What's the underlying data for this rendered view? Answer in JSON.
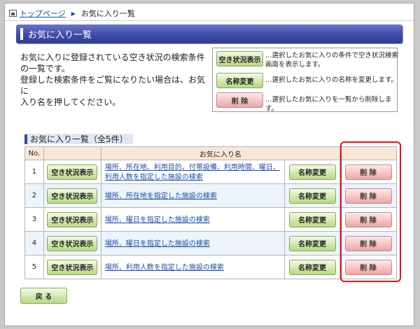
{
  "breadcrumb": {
    "home_link": "トップページ",
    "separator": "▶",
    "current": "お気に入り一覧"
  },
  "page_title": "お気に入り一覧",
  "intro": {
    "line1": "お気に入りに登録されている空き状況の検索条件",
    "line2": "の一覧です。",
    "line3": "登録した検索条件をご覧になりたい場合は、お気に",
    "line4": "入り名を押してください。"
  },
  "legend": {
    "items": [
      {
        "button": "空き状況表示",
        "desc": "…選択したお気に入りの条件で空き状況検索画面を表示します。"
      },
      {
        "button": "名称変更",
        "desc": "…選択したお気に入りの名称を変更します。"
      },
      {
        "button": "削 除",
        "desc": "…選択したお気に入りを一覧から削除します。"
      }
    ]
  },
  "list": {
    "heading": "お気に入り一覧（全5件）",
    "columns": {
      "no": "No.",
      "name": "お気に入り名"
    },
    "rows": [
      {
        "no": "1",
        "view": "空き状況表示",
        "name": "場所、所在地、利用目的、付帯設備、利用時間、曜日、利用人数を指定した施設の検索",
        "rename": "名称変更",
        "delete": "削 除"
      },
      {
        "no": "2",
        "view": "空き状況表示",
        "name": "場所、所在地を指定した施設の検索",
        "rename": "名称変更",
        "delete": "削 除"
      },
      {
        "no": "3",
        "view": "空き状況表示",
        "name": "場所、曜日を指定した施設の検索",
        "rename": "名称変更",
        "delete": "削 除"
      },
      {
        "no": "4",
        "view": "空き状況表示",
        "name": "場所、曜日を指定した施設の検索",
        "rename": "名称変更",
        "delete": "削 除"
      },
      {
        "no": "5",
        "view": "空き状況表示",
        "name": "場所、利用人数を指定した施設の検索",
        "rename": "名称変更",
        "delete": "削 除"
      }
    ]
  },
  "back_button": "戻 る",
  "colors": {
    "title_bar": "#3e4ca6",
    "green_button": "#cfe6a6",
    "red_button": "#f6c0c0",
    "highlight": "#e0141f"
  }
}
